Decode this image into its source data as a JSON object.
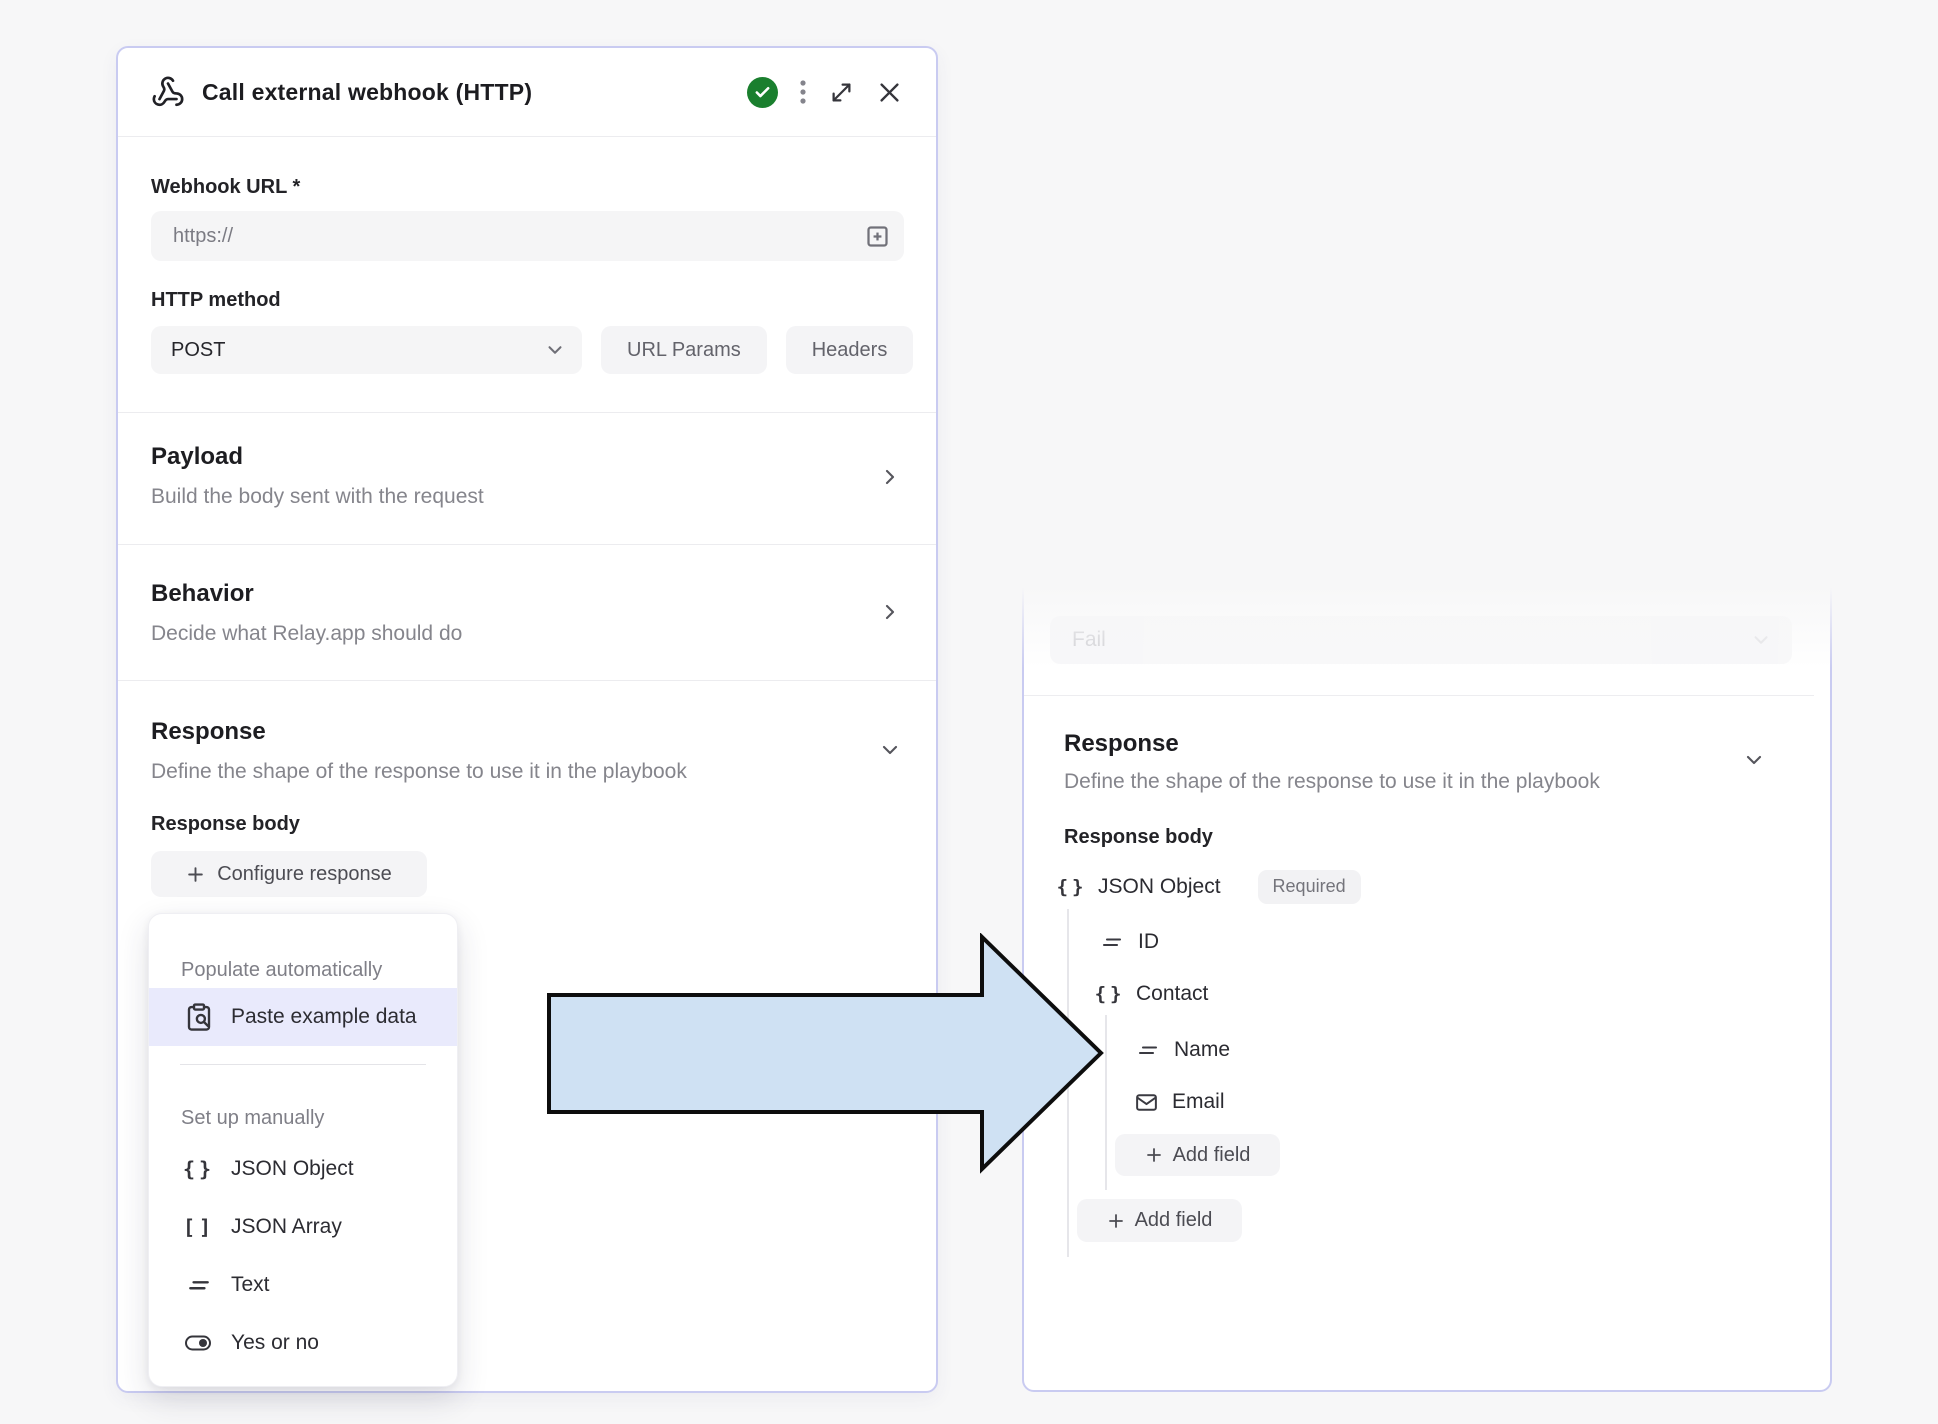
{
  "colors": {
    "page_background": "#f7f7f8",
    "panel_border": "#c9cbf1",
    "menu_highlight": "#e9eafc",
    "success_green": "#1a7f2e",
    "arrow_fill": "#cfe1f3",
    "arrow_stroke": "#0d0d0d"
  },
  "dialog": {
    "title": "Call external webhook (HTTP)",
    "webhook_url_label": "Webhook URL *",
    "webhook_url_placeholder": "https://",
    "http_method_label": "HTTP method",
    "http_method_value": "POST",
    "url_params_button": "URL Params",
    "headers_button": "Headers",
    "payload": {
      "title": "Payload",
      "subtitle": "Build the body sent with the request"
    },
    "behavior": {
      "title": "Behavior",
      "subtitle": "Decide what Relay.app should do"
    },
    "response": {
      "title": "Response",
      "subtitle": "Define the shape of the response to use it in the playbook",
      "body_label": "Response body",
      "configure_button": "Configure response"
    }
  },
  "menu": {
    "populate_section": "Populate automatically",
    "paste_item": {
      "label": "Paste example data",
      "icon": "clipboard-search-icon"
    },
    "manual_section": "Set up manually",
    "items": [
      {
        "label": "JSON Object",
        "icon": "braces-icon"
      },
      {
        "label": "JSON Array",
        "icon": "brackets-icon"
      },
      {
        "label": "Text",
        "icon": "equals-text-icon"
      },
      {
        "label": "Yes or no",
        "icon": "toggle-icon"
      }
    ]
  },
  "right_panel": {
    "fail_value": "Fail",
    "response_title": "Response",
    "response_subtitle": "Define the shape of the response to use it in the playbook",
    "body_label": "Response body",
    "tree": {
      "root_label": "JSON Object",
      "root_badge": "Required",
      "id_label": "ID",
      "contact_label": "Contact",
      "name_label": "Name",
      "email_label": "Email",
      "add_field_label": "Add field"
    }
  },
  "header_icons": [
    "webhook-icon",
    "success-check-icon",
    "kebab-menu-icon",
    "expand-icon",
    "close-icon"
  ]
}
